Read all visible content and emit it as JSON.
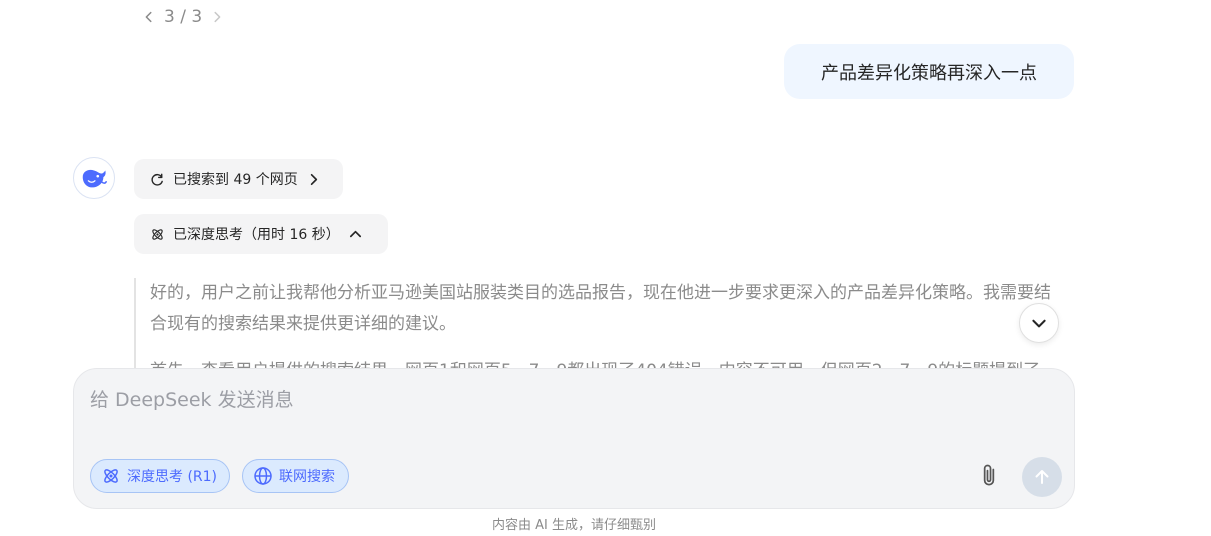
{
  "pager": {
    "label": "3 / 3"
  },
  "user_message": {
    "text": "产品差异化策略再深入一点"
  },
  "assistant": {
    "search_pill": {
      "label": "已搜索到 49 个网页"
    },
    "think_pill": {
      "label": "已深度思考（用时 16 秒）"
    },
    "thought_paragraphs": [
      "好的，用户之前让我帮他分析亚马逊美国站服装类目的选品报告，现在他进一步要求更深入的产品差异化策略。我需要结合现有的搜索结果来提供更详细的建议。",
      "首先，查看用户提供的搜索结果，网页1和网页5、7、9都出现了404错误，内容不可用。但网页2、7、9的标题提到了"
    ]
  },
  "composer": {
    "placeholder": "给 DeepSeek 发送消息",
    "value": "",
    "deep_think_label": "深度思考 (R1)",
    "web_search_label": "联网搜索"
  },
  "footer": {
    "note": "内容由 AI 生成，请仔细甄别"
  },
  "colors": {
    "accent": "#4d6bfe",
    "bubble": "#eff6ff",
    "composer_bg": "#f3f4f6",
    "toggle_bg": "#dbeafe",
    "send_disabled": "#d6dee8"
  }
}
